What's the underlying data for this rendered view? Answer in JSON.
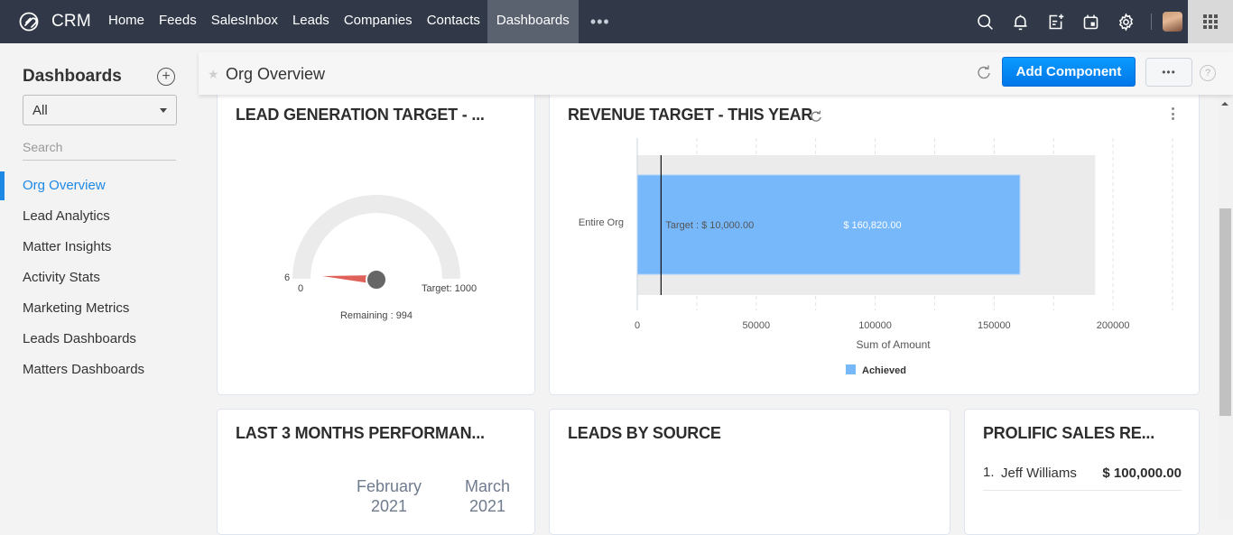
{
  "app": {
    "logo_text": "CRM"
  },
  "topnav": {
    "items": [
      {
        "label": "Home",
        "active": false
      },
      {
        "label": "Feeds",
        "active": false
      },
      {
        "label": "SalesInbox",
        "active": false
      },
      {
        "label": "Leads",
        "active": false
      },
      {
        "label": "Companies",
        "active": false
      },
      {
        "label": "Contacts",
        "active": false
      },
      {
        "label": "Dashboards",
        "active": true
      }
    ],
    "more_label": "•••",
    "right_icons": [
      "search-icon",
      "bell-icon",
      "add-note-icon",
      "calendar-icon",
      "gear-icon"
    ]
  },
  "sidebar": {
    "title": "Dashboards",
    "add_label": "+",
    "filter": {
      "selected": "All"
    },
    "search": {
      "placeholder": "Search"
    },
    "items": [
      {
        "label": "Org Overview",
        "active": true
      },
      {
        "label": "Lead Analytics",
        "active": false
      },
      {
        "label": "Matter Insights",
        "active": false
      },
      {
        "label": "Activity Stats",
        "active": false
      },
      {
        "label": "Marketing Metrics",
        "active": false
      },
      {
        "label": "Leads Dashboards",
        "active": false
      },
      {
        "label": "Matters Dashboards",
        "active": false
      }
    ]
  },
  "header": {
    "title": "Org Overview",
    "add_component_label": "Add Component",
    "more_label": "•••",
    "help_label": "?"
  },
  "colors": {
    "accent": "#1e88e5",
    "button_blue": "#0a8bf5",
    "nav_bg": "#313949",
    "bar_achieved": "#77b8fb",
    "bar_track": "#ebebeb",
    "gauge_needle": "#e0605a",
    "gauge_hub": "#666666"
  },
  "cards": {
    "lead_gen": {
      "title": "LEAD GENERATION TARGET - ...",
      "gauge": {
        "value": 6,
        "min": 0,
        "target": 1000,
        "value_label": "6",
        "min_label": "0",
        "target_label": "Target: 1000",
        "remaining_label": "Remaining : 994"
      }
    },
    "revenue": {
      "title": "REVENUE TARGET - THIS YEAR"
    },
    "last3": {
      "title": "LAST 3 MONTHS PERFORMAN...",
      "months": [
        {
          "month": "February",
          "year": "2021"
        },
        {
          "month": "March",
          "year": "2021"
        }
      ]
    },
    "leads_source": {
      "title": "LEADS BY SOURCE"
    },
    "prolific": {
      "title": "PROLIFIC SALES RE...",
      "rows": [
        {
          "rank": "1.",
          "name": "Jeff Williams",
          "amount": "$ 100,000.00"
        }
      ]
    }
  },
  "chart_data": {
    "type": "bar",
    "orientation": "horizontal",
    "title": "REVENUE TARGET - THIS YEAR",
    "categories": [
      "Entire Org"
    ],
    "series": [
      {
        "name": "Achieved",
        "values": [
          160820
        ],
        "value_labels": [
          "$ 160,820.00"
        ]
      }
    ],
    "target": {
      "value": 10000,
      "label": "Target : $ 10,000.00"
    },
    "track_max": 192500,
    "xlabel": "Sum of Amount",
    "ylabel": "",
    "xlim": [
      0,
      225000
    ],
    "xticks": [
      0,
      50000,
      100000,
      150000,
      200000
    ],
    "xtick_labels": [
      "0",
      "50000",
      "100000",
      "150000",
      "200000"
    ],
    "grid": true,
    "legend": {
      "position": "bottom",
      "entries": [
        "Achieved"
      ]
    }
  }
}
